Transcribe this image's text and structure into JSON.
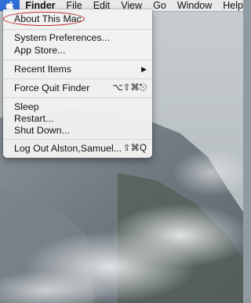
{
  "menubar": {
    "apple_icon": "apple-logo-icon",
    "items": [
      "Finder",
      "File",
      "Edit",
      "View",
      "Go",
      "Window",
      "Help"
    ]
  },
  "apple_menu": {
    "about": "About This Mac",
    "system_prefs": "System Preferences...",
    "app_store": "App Store...",
    "recent_items": "Recent Items",
    "recent_arrow": "▶",
    "force_quit": "Force Quit Finder",
    "force_quit_shortcut": "⌥⇧⌘⎋",
    "sleep": "Sleep",
    "restart": "Restart...",
    "shut_down": "Shut Down...",
    "log_out": "Log Out Alston,Samuel...",
    "log_out_shortcut": "⇧⌘Q"
  },
  "colors": {
    "menubar_highlight": "#2f6fd8",
    "annotation_circle": "#c0262b"
  }
}
